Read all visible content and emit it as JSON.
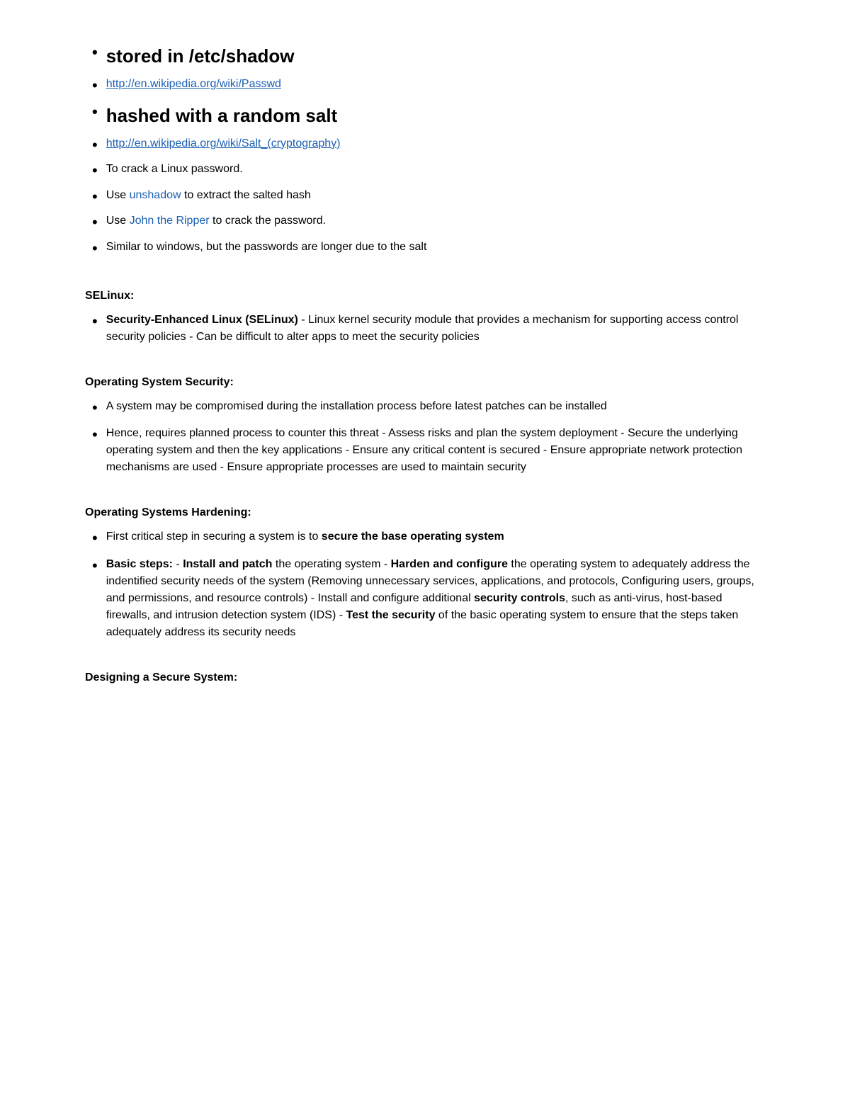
{
  "top_bullets": [
    {
      "id": "stored",
      "large": true,
      "text": "stored in /etc/shadow"
    },
    {
      "id": "passwd-link",
      "large": false,
      "link": true,
      "text": "http://en.wikipedia.org/wiki/Passwd"
    },
    {
      "id": "hashed",
      "large": true,
      "text": "hashed with a random salt"
    },
    {
      "id": "salt-link",
      "large": false,
      "link": true,
      "text": "http://en.wikipedia.org/wiki/Salt_(cryptography)"
    },
    {
      "id": "crack",
      "large": false,
      "text": "To crack a Linux password."
    },
    {
      "id": "unshadow",
      "large": false,
      "has_inline_link": true,
      "text_before": "Use ",
      "link_text": "unshadow",
      "text_after": " to extract the salted hash"
    },
    {
      "id": "john",
      "large": false,
      "has_inline_link": true,
      "text_before": "Use ",
      "link_text": "John the Ripper",
      "text_after": " to crack the password."
    },
    {
      "id": "similar",
      "large": false,
      "text": "Similar to windows, but the passwords are longer due to the salt"
    }
  ],
  "sections": [
    {
      "id": "selinux",
      "title": "SELinux:",
      "bullets": [
        {
          "id": "selinux-desc",
          "html_parts": [
            {
              "type": "bold",
              "text": "Security-Enhanced Linux (SELinux)"
            },
            {
              "type": "plain",
              "text": "  - Linux kernel security module that provides a mechanism for supporting access control security policies   - Can be difficult to alter apps to meet the security policies"
            }
          ]
        }
      ]
    },
    {
      "id": "os-security",
      "title": "Operating System Security:",
      "bullets": [
        {
          "id": "os-compromised",
          "html_parts": [
            {
              "type": "plain",
              "text": "A system may be compromised during the installation process before latest patches can be installed"
            }
          ]
        },
        {
          "id": "os-requires",
          "html_parts": [
            {
              "type": "plain",
              "text": "Hence, requires planned process to counter this threat   - Assess risks and plan the system deployment   - Secure the underlying operating system and then the key applications   - Ensure any critical content is secured   - Ensure appropriate network protection mechanisms are used   - Ensure appropriate processes are used to maintain security"
            }
          ]
        }
      ]
    },
    {
      "id": "os-hardening",
      "title": "Operating Systems Hardening:",
      "bullets": [
        {
          "id": "hardening-first",
          "html_parts": [
            {
              "type": "plain",
              "text": "First critical step in securing a system is to "
            },
            {
              "type": "bold",
              "text": "secure the base operating system"
            }
          ]
        },
        {
          "id": "hardening-basic",
          "html_parts": [
            {
              "type": "bold",
              "text": "Basic steps:"
            },
            {
              "type": "plain",
              "text": "  - "
            },
            {
              "type": "bold",
              "text": "Install and patch"
            },
            {
              "type": "plain",
              "text": " the operating system   - "
            },
            {
              "type": "bold",
              "text": "Harden and configure"
            },
            {
              "type": "plain",
              "text": " the operating system to adequately address the indentified security needs of the system (Removing unnecessary services, applications, and protocols, Configuring users, groups, and permissions, and resource controls)   - Install and configure additional "
            },
            {
              "type": "bold",
              "text": "security controls"
            },
            {
              "type": "plain",
              "text": ", such as anti-virus, host-based firewalls, and intrusion detection system (IDS)   - "
            },
            {
              "type": "bold",
              "text": "Test the security"
            },
            {
              "type": "plain",
              "text": " of the basic operating system to ensure that the steps taken adequately address its security needs"
            }
          ]
        }
      ]
    },
    {
      "id": "designing",
      "title": "Designing a Secure System:",
      "bullets": []
    }
  ]
}
